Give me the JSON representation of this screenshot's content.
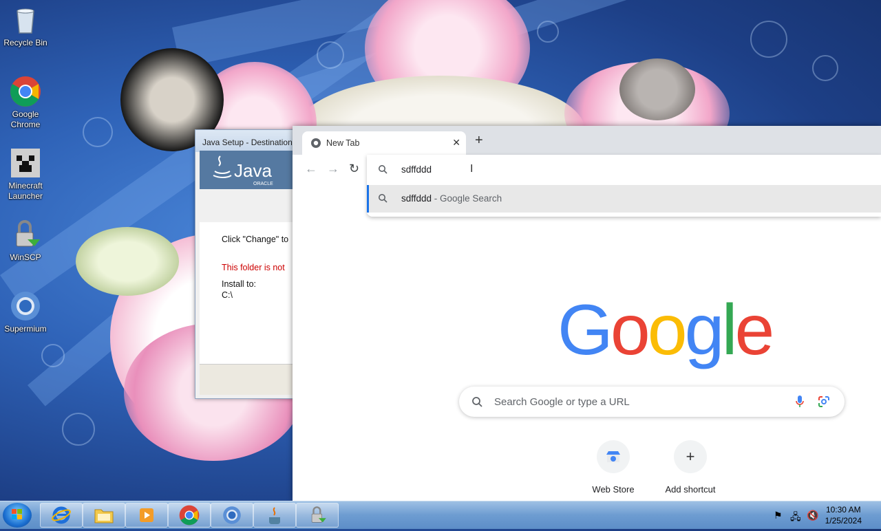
{
  "desktop": {
    "icons": [
      {
        "label": "Recycle Bin",
        "icon": "recycle-bin-icon"
      },
      {
        "label": "Google Chrome",
        "icon": "chrome-icon"
      },
      {
        "label": "Minecraft Launcher",
        "icon": "minecraft-icon"
      },
      {
        "label": "WinSCP",
        "icon": "winscp-icon"
      },
      {
        "label": "Supermium",
        "icon": "supermium-icon"
      }
    ]
  },
  "java_window": {
    "title": "Java Setup - Destination",
    "logo_text": "Java",
    "logo_sub": "ORACLE",
    "instruction": "Click \"Change\" to",
    "warning": "This folder is not",
    "install_label": "Install to:",
    "install_path": "C:\\"
  },
  "chrome": {
    "tab_title": "New Tab",
    "omnibox_value": "sdffddd",
    "suggestion_query": "sdffddd",
    "suggestion_suffix": " - Google Search",
    "logo": "Google",
    "search_placeholder": "Search Google or type a URL",
    "shortcuts": [
      {
        "label": "Web Store",
        "icon": "web-store-icon"
      },
      {
        "label": "Add shortcut",
        "icon": "plus-icon"
      }
    ]
  },
  "taskbar": {
    "time": "10:30 AM",
    "date": "1/25/2024",
    "pinned": [
      "internet-explorer-icon",
      "file-explorer-icon",
      "media-player-icon",
      "chrome-icon",
      "supermium-icon",
      "java-installer-icon",
      "winscp-icon"
    ]
  },
  "colors": {
    "google_blue": "#4285f4",
    "google_red": "#ea4335",
    "google_yellow": "#fbbc05",
    "google_green": "#34a853",
    "warning_red": "#cc0000"
  }
}
